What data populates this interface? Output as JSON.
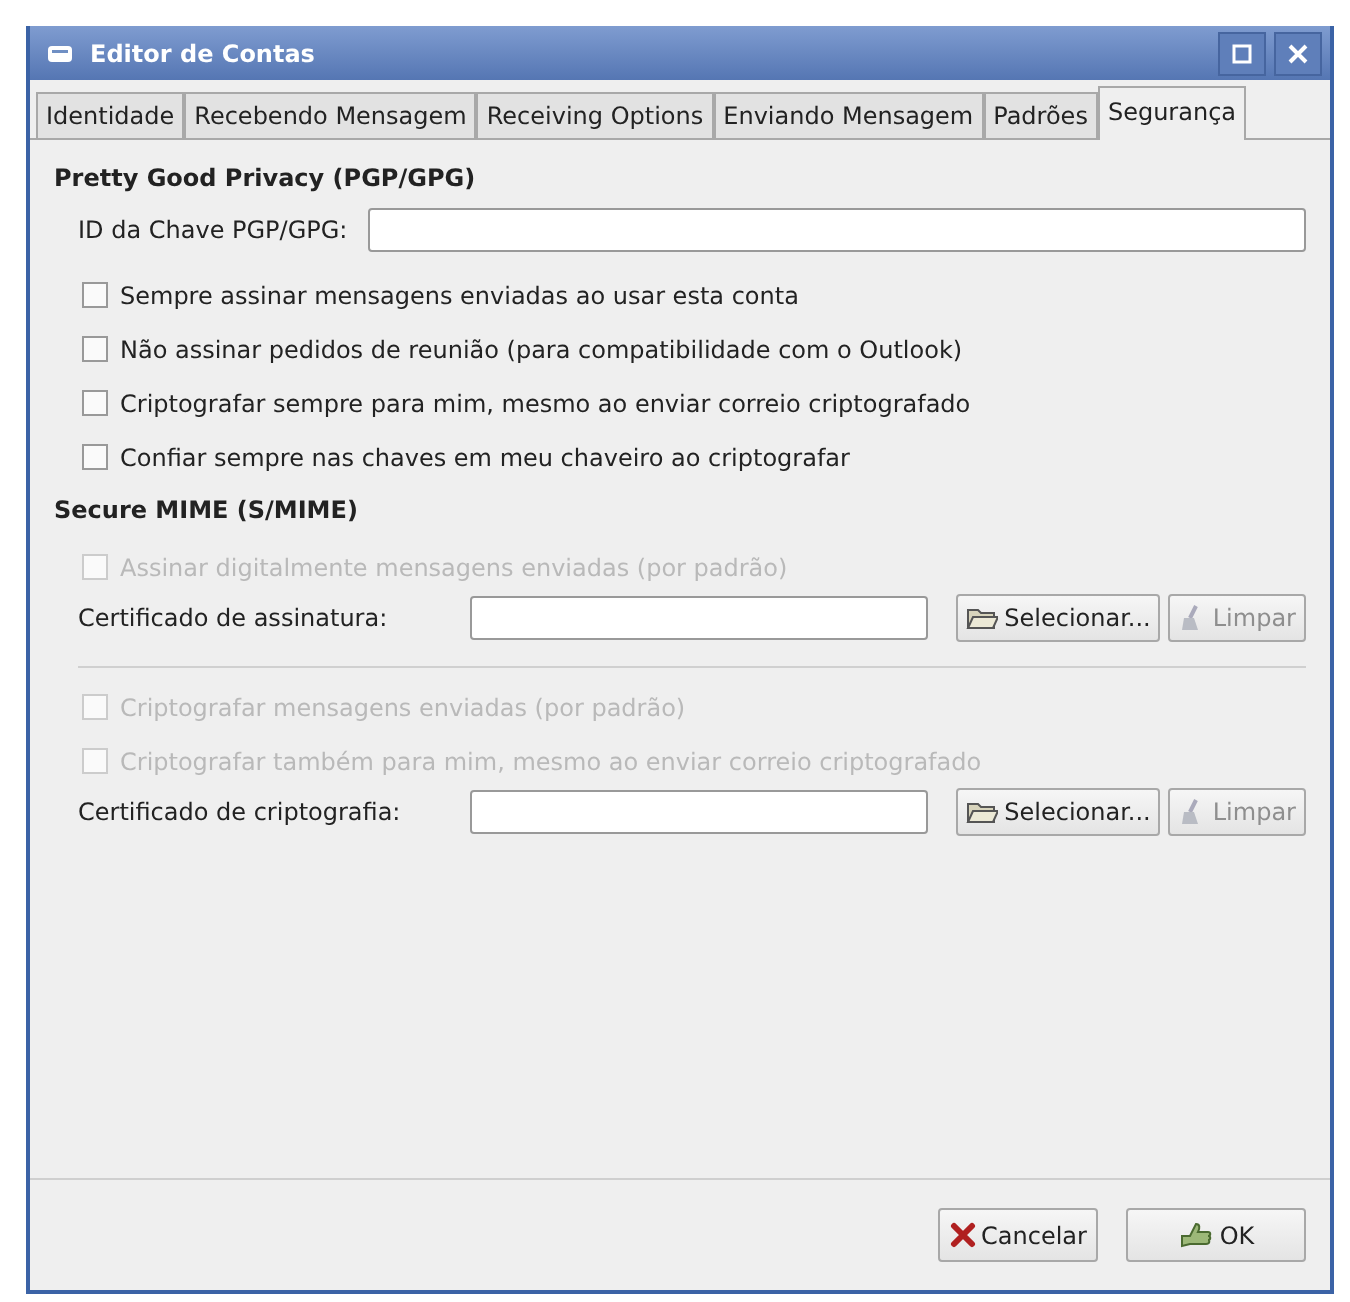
{
  "window": {
    "title": "Editor de Contas"
  },
  "tabs": [
    {
      "label": "Identidade",
      "selected": false
    },
    {
      "label": "Recebendo Mensagem",
      "selected": false
    },
    {
      "label": "Receiving Options",
      "selected": false
    },
    {
      "label": "Enviando Mensagem",
      "selected": false
    },
    {
      "label": "Padrões",
      "selected": false
    },
    {
      "label": "Segurança",
      "selected": true
    }
  ],
  "sections": [
    {
      "heading": "Pretty Good Privacy (PGP/GPG)",
      "items": [
        {
          "kind": "field",
          "label": "ID da Chave PGP/GPG:"
        },
        {
          "kind": "checkbox",
          "label": "Sempre assinar mensagens enviadas ao usar esta conta",
          "checked": false,
          "disabled": false
        },
        {
          "kind": "checkbox",
          "label": "Não assinar pedidos de reunião (para compatibilidade com o Outlook)",
          "checked": false,
          "disabled": false
        },
        {
          "kind": "checkbox",
          "label": "Criptografar sempre para mim, mesmo ao enviar correio criptografado",
          "checked": false,
          "disabled": false
        },
        {
          "kind": "checkbox",
          "label": "Confiar sempre nas chaves em meu chaveiro ao criptografar",
          "checked": false,
          "disabled": false
        }
      ]
    },
    {
      "heading": "Secure MIME (S/MIME)",
      "items": [
        {
          "kind": "checkbox",
          "label": "Assinar digitalmente mensagens enviadas (por padrão)",
          "checked": false,
          "disabled": true
        },
        {
          "kind": "certificate",
          "label": "Certificado de assinatura:",
          "select": "Selecionar...",
          "clear": "Limpar"
        },
        {
          "kind": "separator"
        },
        {
          "kind": "checkbox",
          "label": "Criptografar mensagens enviadas (por padrão)",
          "checked": false,
          "disabled": true
        },
        {
          "kind": "checkbox",
          "label": "Criptografar também para mim, mesmo ao enviar correio criptografado",
          "checked": false,
          "disabled": true
        },
        {
          "kind": "certificate",
          "label": "Certificado de criptografia:",
          "select": "Selecionar...",
          "clear": "Limpar"
        }
      ]
    }
  ],
  "buttons": [
    {
      "kind": "cancel",
      "label": "Cancelar"
    },
    {
      "kind": "ok",
      "label": "OK"
    }
  ]
}
